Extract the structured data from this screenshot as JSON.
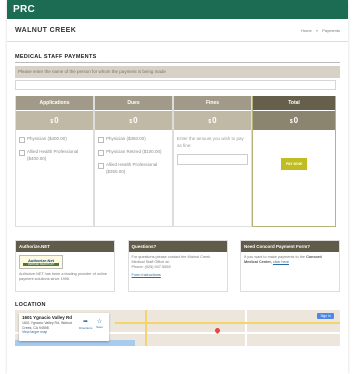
{
  "header": {
    "brand": "PRC",
    "city": "WALNUT CREEK",
    "breadcrumb": [
      "Home",
      "Payments"
    ]
  },
  "payments": {
    "section_title": "MEDICAL STAFF PAYMENTS",
    "instruction": "Please enter the name of the person for whom the payment is being made",
    "name_value": "",
    "currency": "$",
    "columns": {
      "applications": {
        "label": "Applications",
        "amount": "0"
      },
      "dues": {
        "label": "Dues",
        "amount": "0"
      },
      "fines": {
        "label": "Fines",
        "amount": "0"
      },
      "total": {
        "label": "Total",
        "amount": "0"
      }
    },
    "applications_options": [
      "Physician ($400.00)",
      "Allied Health Professional ($400.00)"
    ],
    "dues_options": [
      "Physician ($350.00)",
      "Physician Retired ($100.00)",
      "Allied Health Professional ($350.00)"
    ],
    "fines_prompt": "Enter the amount you wish to pay as fine:",
    "fines_value": "",
    "pay_button": "PAY NOW"
  },
  "panels": {
    "authorize": {
      "title": "Authorize.NET",
      "logo_text": "Authorize.Net",
      "logo_badge": "VERIFIED MERCHANT",
      "body": "Authorize.NET has been a leading provider of online payment solutions since 1996."
    },
    "questions": {
      "title": "Questions?",
      "body": "For questions please contact the Walnut Creek Medical Staff Office at:",
      "phone": "Phone: (925) 947-5559",
      "link": "Form Instructions"
    },
    "concord": {
      "title": "Need Concord Payment Form?",
      "body_prefix": "If you want to make payments to the",
      "body_bold": "Concord Medical Center,",
      "link": "click here"
    }
  },
  "location": {
    "title": "LOCATION",
    "place_name": "1601 Ygnacio Valley Rd",
    "address": "1601 Ygnacio Valley Rd, Walnut Creek, CA 94598",
    "larger_map_link": "View larger map",
    "directions_label": "Directions",
    "save_label": "Save",
    "sign_in_label": "Sign in"
  }
}
